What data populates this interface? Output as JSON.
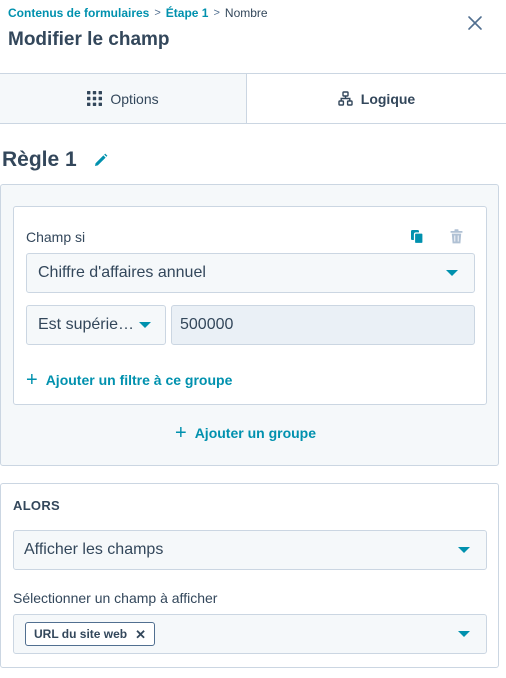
{
  "breadcrumb": {
    "items": [
      "Contenus de formulaires",
      "Étape 1"
    ],
    "current": "Nombre",
    "separator": ">"
  },
  "header": {
    "title": "Modifier le champ"
  },
  "tabs": [
    {
      "label": "Options",
      "icon": "grid-icon",
      "active": false
    },
    {
      "label": "Logique",
      "icon": "branch-icon",
      "active": true
    }
  ],
  "rule": {
    "title": "Règle 1"
  },
  "conditions": {
    "group_label": "Champ si",
    "field_select": "Chiffre d'affaires annuel",
    "operator_select": "Est supérie…",
    "value": "500000",
    "add_filter_label": "Ajouter un filtre à ce groupe",
    "add_group_label": "Ajouter un groupe"
  },
  "then": {
    "label": "ALORS",
    "action_select": "Afficher les champs",
    "field_label": "Sélectionner un champ à afficher",
    "selected_tags": [
      "URL du site web"
    ]
  },
  "colors": {
    "accent": "#0091ae",
    "text": "#33475b",
    "border": "#cbd6e2",
    "panel_bg": "#f5f8fa"
  }
}
